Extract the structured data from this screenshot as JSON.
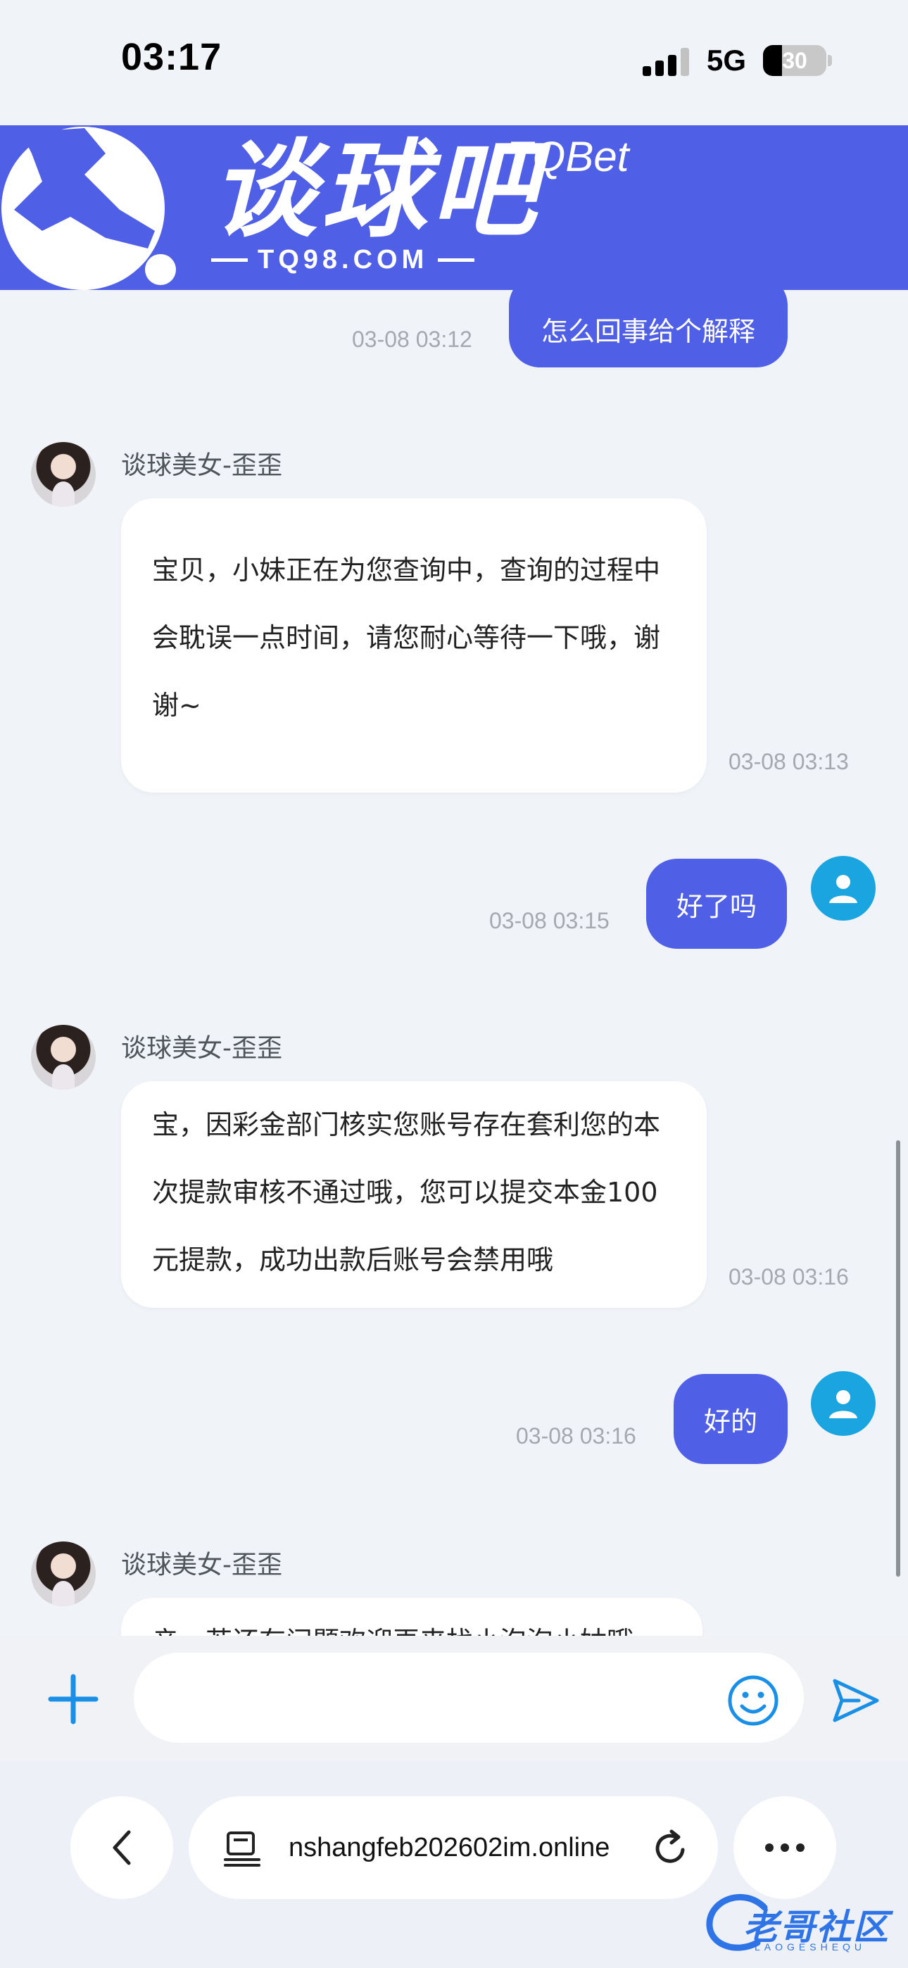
{
  "status_bar": {
    "time": "03:17",
    "network": "5G",
    "battery": "30",
    "battery_level_percent": 30
  },
  "banner": {
    "brand_name": "谈球吧",
    "brand_en": "TQBet",
    "brand_url": "TQ98.COM",
    "color": "#4f5fe6"
  },
  "chat": {
    "messages": [
      {
        "sender": "user",
        "text": "怎么回事给个解释",
        "time": "03-08 03:12"
      },
      {
        "sender": "agent",
        "name": "谈球美女-歪歪",
        "lines": [
          "宝贝，小妹正在为您查询中，查询的过程中",
          "会耽误一点时间，请您耐心等待一下哦，谢",
          "谢~"
        ],
        "time": "03-08 03:13"
      },
      {
        "sender": "user",
        "text": "好了吗",
        "time": "03-08 03:15"
      },
      {
        "sender": "agent",
        "name": "谈球美女-歪歪",
        "lines": [
          "宝，因彩金部门核实您账号存在套利您的本",
          "次提款审核不通过哦，您可以提交本金100",
          "元提款，成功出款后账号会禁用哦"
        ],
        "time": "03-08 03:16"
      },
      {
        "sender": "user",
        "text": "好的",
        "time": "03-08 03:16"
      },
      {
        "sender": "agent",
        "name": "谈球美女-歪歪",
        "lines": [
          "亲，若还有问题欢迎再来找小泡泡小姑哦"
        ]
      }
    ],
    "accent_color": "#4f5fe6",
    "user_avatar_color": "#1aa5e0"
  },
  "input_bar": {
    "placeholder": "",
    "plus_icon": "plus-icon",
    "emoji_icon": "emoji-icon",
    "send_icon": "send-icon"
  },
  "browser": {
    "url": "nshangfeb202602im.online",
    "back_icon": "chevron-left-icon",
    "tabs_icon": "tabs-icon",
    "reload_icon": "reload-icon",
    "more_icon": "more-icon"
  },
  "watermark": {
    "text": "老哥社区",
    "sub": "LAOGESHEQU"
  }
}
